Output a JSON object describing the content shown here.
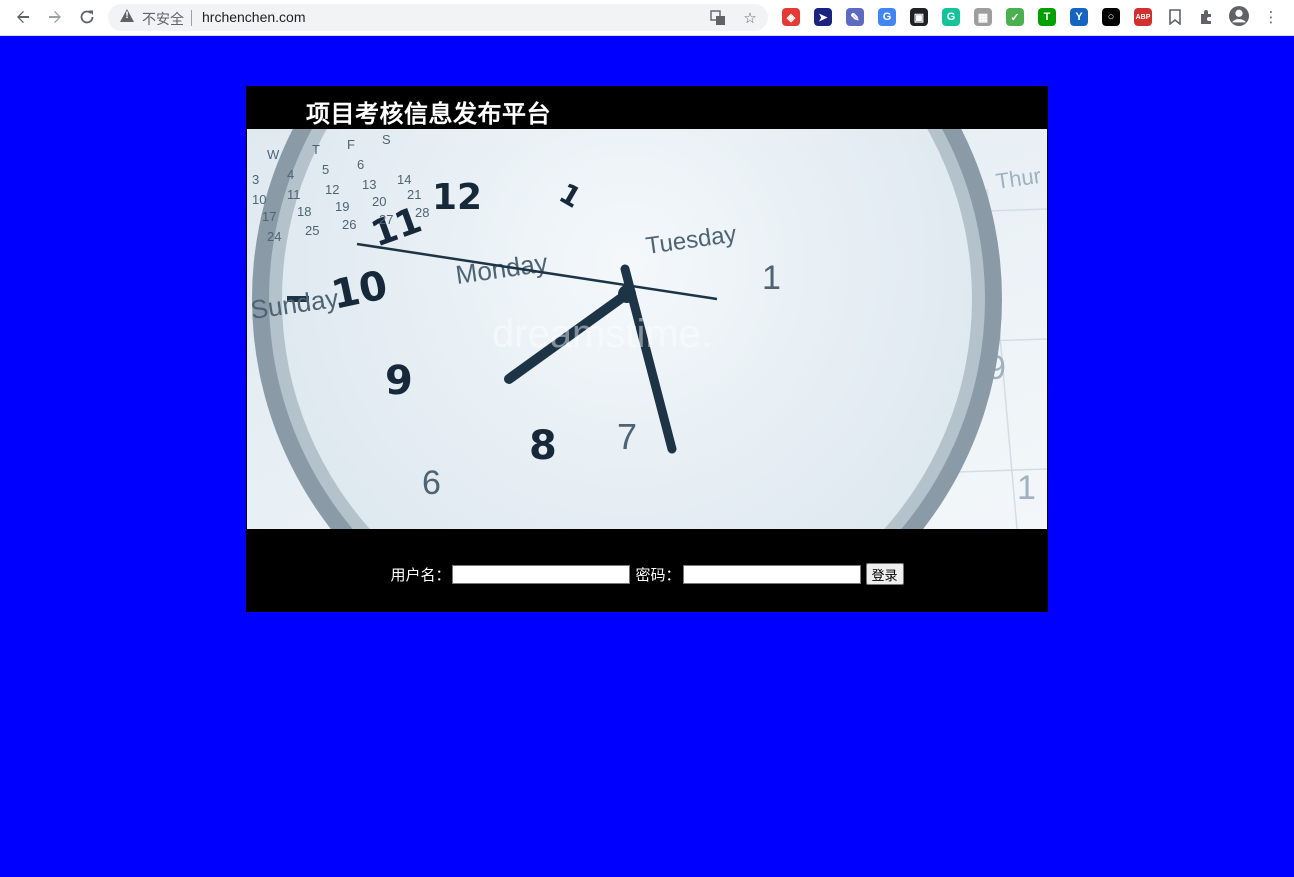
{
  "browser": {
    "security_label": "不安全",
    "url": "hrchenchen.com",
    "extensions": [
      {
        "name": "shield-extension-icon",
        "color": "#e53935",
        "glyph": "◈"
      },
      {
        "name": "cursor-extension-icon",
        "color": "#1a237e",
        "glyph": "➤"
      },
      {
        "name": "pen-extension-icon",
        "color": "#5c6bc0",
        "glyph": "✎"
      },
      {
        "name": "translate-extension-icon",
        "color": "#4285f4",
        "glyph": "G"
      },
      {
        "name": "picture-in-picture-icon",
        "color": "#202124",
        "glyph": "▣"
      },
      {
        "name": "grammarly-icon",
        "color": "#15c39a",
        "glyph": "G"
      },
      {
        "name": "tab-manager-icon",
        "color": "#9e9e9e",
        "glyph": "▦"
      },
      {
        "name": "vpn-shield-icon",
        "color": "#4caf50",
        "glyph": "✓"
      },
      {
        "name": "tampermonkey-icon",
        "color": "#00a000",
        "glyph": "T"
      },
      {
        "name": "y-extension-icon",
        "color": "#1565c0",
        "glyph": "Y"
      },
      {
        "name": "circle-extension-icon",
        "color": "#000000",
        "glyph": "○"
      },
      {
        "name": "adblock-plus-icon",
        "color": "#d32f2f",
        "glyph": "ABP"
      }
    ]
  },
  "page": {
    "background_color": "#0000ff",
    "title": "项目考核信息发布平台",
    "banner_alt": "clock and calendar",
    "watermark": "dreamstime.",
    "login": {
      "username_label": "用户名：",
      "password_label": "密码：",
      "username_value": "",
      "password_value": "",
      "submit_label": "登录"
    }
  }
}
